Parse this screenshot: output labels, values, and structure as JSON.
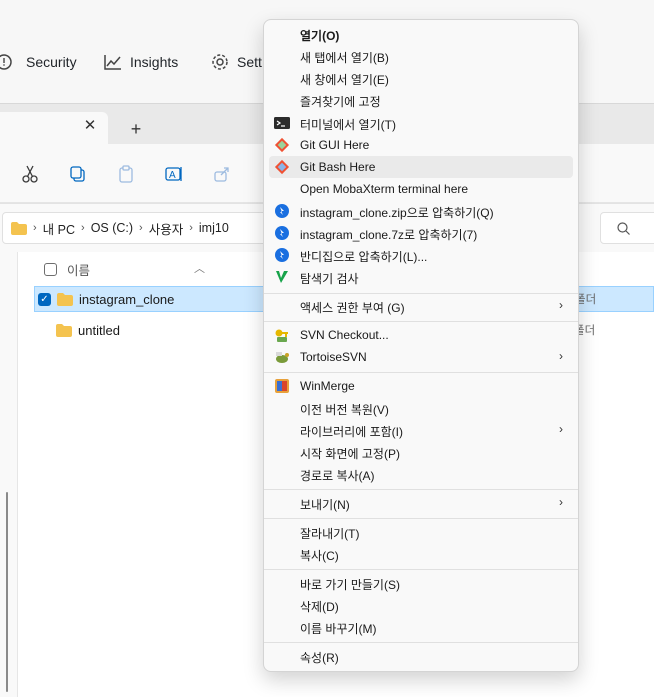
{
  "browser": {
    "tabs": [
      {
        "label": "Security",
        "icon": "shield-alert-icon"
      },
      {
        "label": "Insights",
        "icon": "graph-icon"
      },
      {
        "label": "Sett",
        "icon": "gear-icon"
      }
    ]
  },
  "explorer": {
    "tab_close": "✕",
    "tab_add": "+",
    "breadcrumb": [
      "내 PC",
      "OS (C:)",
      "사용자",
      "imj10"
    ],
    "column_name": "이름",
    "files": [
      {
        "name": "instagram_clone",
        "type": "폴더",
        "selected": true
      },
      {
        "name": "untitled",
        "type": "폴더",
        "selected": false
      }
    ]
  },
  "context_menu": {
    "items": [
      {
        "label": "열기(O)",
        "bold": true
      },
      {
        "label": "새 탭에서 열기(B)"
      },
      {
        "label": "새 창에서 열기(E)"
      },
      {
        "label": "즐겨찾기에 고정"
      },
      {
        "label": "터미널에서 열기(T)",
        "icon": "terminal-icon"
      },
      {
        "label": "Git GUI Here",
        "icon": "git-icon"
      },
      {
        "label": "Git Bash Here",
        "icon": "git-icon",
        "hover": true
      },
      {
        "label": "Open MobaXterm terminal here"
      },
      {
        "label": "instagram_clone.zip으로 압축하기(Q)",
        "icon": "bandizip-icon"
      },
      {
        "label": "instagram_clone.7z로 압축하기(7)",
        "icon": "bandizip-icon"
      },
      {
        "label": "반디집으로 압축하기(L)...",
        "icon": "bandizip-icon"
      },
      {
        "label": "탐색기 검사",
        "icon": "v3-icon"
      },
      {
        "label": "액세스 권한 부여 (G)",
        "submenu": true
      },
      {
        "label": "SVN Checkout...",
        "icon": "svn-checkout-icon"
      },
      {
        "label": "TortoiseSVN",
        "icon": "tortoisesvn-icon",
        "submenu": true
      },
      {
        "label": "WinMerge",
        "icon": "winmerge-icon"
      },
      {
        "label": "이전 버전 복원(V)"
      },
      {
        "label": "라이브러리에 포함(I)",
        "submenu": true
      },
      {
        "label": "시작 화면에 고정(P)"
      },
      {
        "label": "경로로 복사(A)"
      },
      {
        "label": "보내기(N)",
        "submenu": true
      },
      {
        "label": "잘라내기(T)"
      },
      {
        "label": "복사(C)"
      },
      {
        "label": "바로 가기 만들기(S)"
      },
      {
        "label": "삭제(D)"
      },
      {
        "label": "이름 바꾸기(M)"
      },
      {
        "label": "속성(R)"
      }
    ],
    "submenu_arrow": "›"
  },
  "colors": {
    "accent": "#0067c0",
    "selection_bg": "#cce8ff",
    "menu_bg": "#f9f9f9",
    "menu_hover": "#eaeaea"
  }
}
